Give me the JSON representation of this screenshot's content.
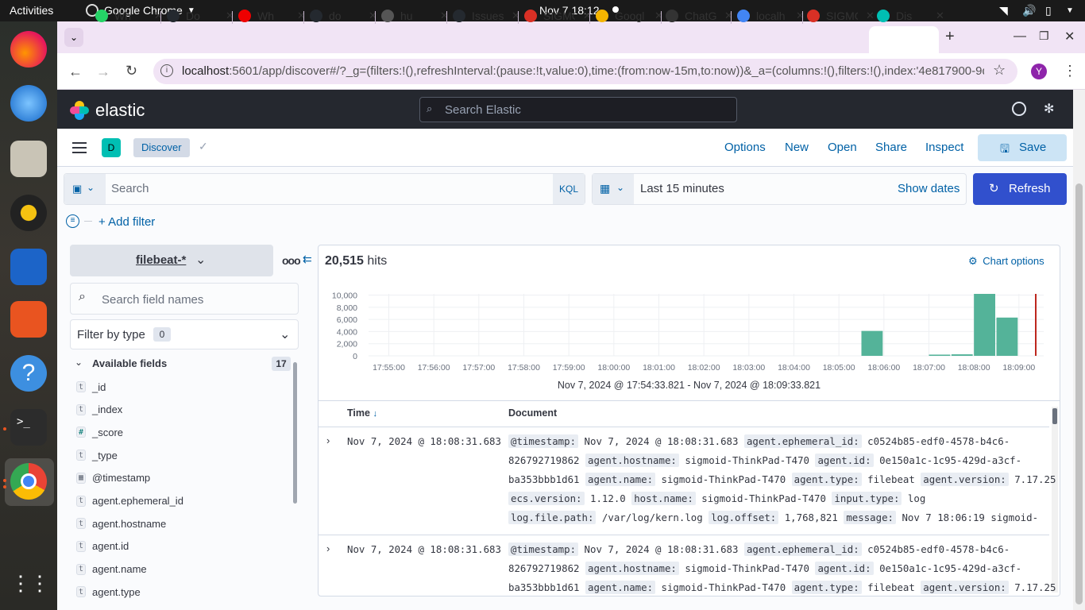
{
  "system": {
    "activities": "Activities",
    "app_menu": "Google Chrome",
    "clock": "Nov 7  18:12"
  },
  "browser": {
    "tabs": [
      {
        "label": "Wh",
        "icon": "whatsapp-icon",
        "color": "#25d366"
      },
      {
        "label": "Do",
        "icon": "github-icon",
        "color": "#24292f"
      },
      {
        "label": "Wh",
        "icon": "error-icon",
        "color": "#e00"
      },
      {
        "label": "do",
        "icon": "github-icon",
        "color": "#24292f"
      },
      {
        "label": "hu",
        "icon": "huggingface-icon",
        "color": "#555"
      },
      {
        "label": "Issues",
        "icon": "github-icon",
        "color": "#24292f"
      },
      {
        "label": "SIGMO",
        "icon": "gmail-icon",
        "color": "#d93025"
      },
      {
        "label": "Googl",
        "icon": "google-slides-icon",
        "color": "#f4b400"
      },
      {
        "label": "ChatG",
        "icon": "chatgpt-icon",
        "color": "#333"
      },
      {
        "label": "localh",
        "icon": "google-icon",
        "color": "#4285f4"
      },
      {
        "label": "SIGMO",
        "icon": "gmail-icon",
        "color": "#d93025"
      },
      {
        "label": "Dis",
        "icon": "elastic-icon",
        "color": "#00bfb3"
      }
    ],
    "url_host": "localhost",
    "url_rest": ":5601/app/discover#/?_g=(filters:!(),refreshInterval:(pause:!t,value:0),time:(from:now-15m,to:now))&_a=(columns:!(),filters:!(),index:'4e817900-9d05-...",
    "profile_initial": "Y"
  },
  "kibana": {
    "brand": "elastic",
    "search_placeholder": "Search Elastic",
    "space_initial": "D",
    "breadcrumb": "Discover",
    "nav": {
      "options": "Options",
      "new": "New",
      "open": "Open",
      "share": "Share",
      "inspect": "Inspect",
      "save": "Save"
    },
    "query": {
      "placeholder": "Search",
      "language": "KQL",
      "time_range": "Last 15 minutes",
      "show_dates": "Show dates",
      "refresh": "Refresh",
      "add_filter": "+ Add filter"
    },
    "sidebar": {
      "index_pattern": "filebeat-*",
      "search_placeholder": "Search field names",
      "filter_by_type": "Filter by type",
      "filter_count": "0",
      "available_fields": "Available fields",
      "available_count": "17",
      "fields": [
        {
          "type": "t",
          "name": "_id"
        },
        {
          "type": "t",
          "name": "_index"
        },
        {
          "type": "#",
          "name": "_score"
        },
        {
          "type": "t",
          "name": "_type"
        },
        {
          "type": "date",
          "name": "@timestamp"
        },
        {
          "type": "t",
          "name": "agent.ephemeral_id"
        },
        {
          "type": "t",
          "name": "agent.hostname"
        },
        {
          "type": "t",
          "name": "agent.id"
        },
        {
          "type": "t",
          "name": "agent.name"
        },
        {
          "type": "t",
          "name": "agent.type"
        }
      ]
    },
    "hits": {
      "count": "20,515",
      "label": "hits"
    },
    "chart_options": "Chart options",
    "time_range_label": "Nov 7, 2024 @ 17:54:33.821 - Nov 7, 2024 @ 18:09:33.821",
    "table": {
      "col_time": "Time",
      "col_document": "Document",
      "rows": [
        {
          "time": "Nov 7, 2024 @ 18:08:31.683",
          "lines": [
            [
              [
                "@timestamp:",
                "Nov 7, 2024 @ 18:08:31.683"
              ],
              [
                "agent.ephemeral_id:",
                "c0524b85-edf0-4578-b4c6-"
              ]
            ],
            [
              [
                "",
                "826792719862"
              ],
              [
                "agent.hostname:",
                "sigmoid-ThinkPad-T470"
              ],
              [
                "agent.id:",
                "0e150a1c-1c95-429d-a3cf-"
              ]
            ],
            [
              [
                "",
                "ba353bbb1d61"
              ],
              [
                "agent.name:",
                "sigmoid-ThinkPad-T470"
              ],
              [
                "agent.type:",
                "filebeat"
              ],
              [
                "agent.version:",
                "7.17.25"
              ]
            ],
            [
              [
                "ecs.version:",
                "1.12.0"
              ],
              [
                "host.name:",
                "sigmoid-ThinkPad-T470"
              ],
              [
                "input.type:",
                "log"
              ]
            ],
            [
              [
                "log.file.path:",
                "/var/log/kern.log"
              ],
              [
                "log.offset:",
                "1,768,821"
              ],
              [
                "message:",
                "Nov 7 18:06:19 sigmoid-"
              ]
            ]
          ]
        },
        {
          "time": "Nov 7, 2024 @ 18:08:31.683",
          "lines": [
            [
              [
                "@timestamp:",
                "Nov 7, 2024 @ 18:08:31.683"
              ],
              [
                "agent.ephemeral_id:",
                "c0524b85-edf0-4578-b4c6-"
              ]
            ],
            [
              [
                "",
                "826792719862"
              ],
              [
                "agent.hostname:",
                "sigmoid-ThinkPad-T470"
              ],
              [
                "agent.id:",
                "0e150a1c-1c95-429d-a3cf-"
              ]
            ],
            [
              [
                "",
                "ba353bbb1d61"
              ],
              [
                "agent.name:",
                "sigmoid-ThinkPad-T470"
              ],
              [
                "agent.type:",
                "filebeat"
              ],
              [
                "agent.version:",
                "7.17.25"
              ]
            ]
          ]
        }
      ]
    }
  },
  "chart_data": {
    "type": "bar",
    "categories": [
      "17:55:00",
      "17:56:00",
      "17:57:00",
      "17:58:00",
      "17:59:00",
      "18:00:00",
      "18:01:00",
      "18:02:00",
      "18:03:00",
      "18:04:00",
      "18:05:00",
      "18:06:00",
      "18:07:00",
      "18:08:00",
      "18:09:00"
    ],
    "x_tick_labels": [
      "17:55:00",
      "17:56:00",
      "17:57:00",
      "17:58:00",
      "17:59:00",
      "18:00:00",
      "18:01:00",
      "18:02:00",
      "18:03:00",
      "18:04:00",
      "18:05:00",
      "18:06:00",
      "18:07:00",
      "18:08:00",
      "18:09:00"
    ],
    "y_tick_labels": [
      "0",
      "2,000",
      "4,000",
      "6,000",
      "8,000",
      "10,000"
    ],
    "bars": [
      {
        "x": "18:05:30",
        "value": 4100
      },
      {
        "x": "18:07:00",
        "value": 200
      },
      {
        "x": "18:07:30",
        "value": 250
      },
      {
        "x": "18:08:00",
        "value": 10200
      },
      {
        "x": "18:08:30",
        "value": 6300
      }
    ],
    "ylim": [
      0,
      10200
    ],
    "bar_color": "#54b399",
    "now_marker_color": "#bd271e"
  }
}
